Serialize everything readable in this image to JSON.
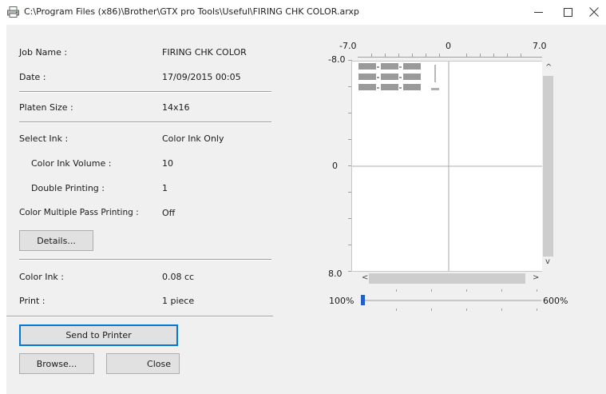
{
  "window": {
    "title": "C:\\Program Files (x86)\\Brother\\GTX pro Tools\\Useful\\FIRING CHK COLOR.arxp",
    "minimize_glyph": "—",
    "maximize_glyph": "☐",
    "close_glyph": "✕"
  },
  "info": {
    "job_name_label": "Job Name :",
    "job_name_value": "FIRING CHK COLOR",
    "date_label": "Date :",
    "date_value": "17/09/2015 00:05",
    "platen_size_label": "Platen Size :",
    "platen_size_value": "14x16",
    "select_ink_label": "Select Ink :",
    "select_ink_value": "Color Ink Only",
    "color_ink_volume_label": "Color Ink Volume :",
    "color_ink_volume_value": "10",
    "double_printing_label": "Double Printing :",
    "double_printing_value": "1",
    "color_multi_pass_label": "Color Multiple Pass Printing :",
    "color_multi_pass_value": "Off",
    "details_button": "Details...",
    "color_ink_label": "Color Ink :",
    "color_ink_value": "0.08 cc",
    "print_label": "Print :",
    "print_value": "1 piece"
  },
  "buttons": {
    "send_to_printer": "Send to Printer",
    "browse": "Browse...",
    "close": "Close"
  },
  "preview": {
    "x_axis_ticks": [
      "-7.0",
      "0",
      "7.0"
    ],
    "y_axis_ticks": [
      "-8.0",
      "0",
      "8.0"
    ],
    "scroll_up": "^",
    "scroll_down": "v",
    "scroll_left": "<",
    "scroll_right": ">"
  },
  "zoom": {
    "min_label": "100%",
    "max_label": "600%",
    "level_fraction": 0.0
  }
}
